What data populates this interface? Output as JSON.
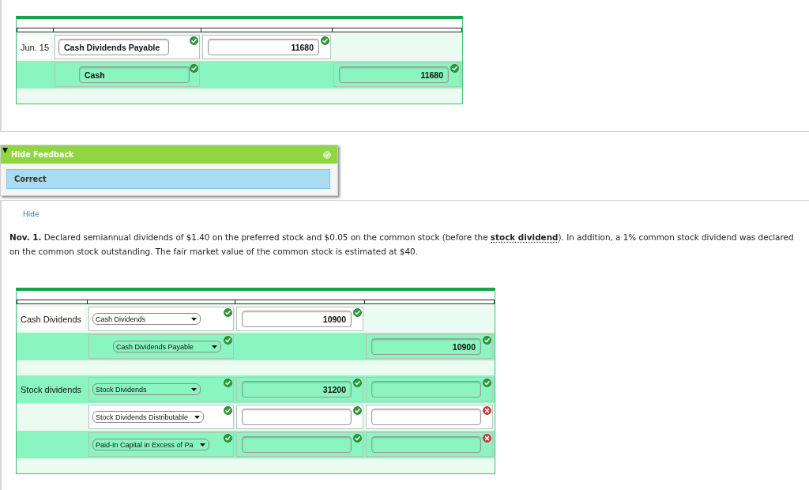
{
  "journal_1": {
    "rows": [
      {
        "kind": "entry",
        "column_1": "Jun. 15",
        "column_2": {
          "kind": "text",
          "value": "Cash Dividends Payable",
          "indented": false,
          "correct": true
        },
        "column_3": {
          "value": "11680",
          "correct": true
        }
      },
      {
        "kind": "entry",
        "column_2": {
          "kind": "text",
          "value": "Cash",
          "indented": true,
          "correct": true
        },
        "column_4": {
          "value": "11680",
          "correct": true
        }
      },
      {
        "kind": "spacer"
      }
    ]
  },
  "feedback": {
    "title": "Hide Feedback",
    "expanded": true,
    "correct": true,
    "message": "Correct"
  },
  "hide_link": "Hide",
  "question": {
    "before": "**Nov. 1.** Declared semiannual dividends of $1.40 on the preferred stock and $0.05 on the common stock (before the ",
    "term": "stock dividend",
    "after": "). In addition, a 1% common stock dividend was declared on the common stock outstanding. The fair market value of the common stock is estimated at $40."
  },
  "journal_2": {
    "rows": [
      {
        "kind": "entry",
        "column_1": "Cash Dividends",
        "column_2": {
          "kind": "select",
          "value": "Cash Dividends",
          "indented": false,
          "correct": true
        },
        "column_3": {
          "value": "10900",
          "correct": true
        }
      },
      {
        "kind": "entry",
        "column_2": {
          "kind": "select",
          "value": "Cash Dividends Payable",
          "indented": true,
          "correct": true
        },
        "column_4": {
          "value": "10900",
          "correct": true
        }
      },
      {
        "kind": "spacer"
      },
      {
        "kind": "entry",
        "column_1": "Stock dividends",
        "column_2": {
          "kind": "select",
          "value": "Stock Dividends",
          "indented": false,
          "correct": true
        },
        "column_3": {
          "value": "31200",
          "correct": true
        },
        "column_4": {
          "correct": true
        }
      },
      {
        "kind": "entry",
        "column_2": {
          "kind": "select",
          "value": "Stock Dividends Distributable",
          "indented": false,
          "correct": true
        },
        "column_3": {
          "correct": true
        },
        "column_4": {
          "correct": false
        }
      },
      {
        "kind": "entry",
        "column_2": {
          "kind": "select",
          "value": "Paid-In Capital in Excess of Pa",
          "indented": false,
          "correct": true
        },
        "column_3": {
          "correct": true
        },
        "column_4": {
          "correct": false
        }
      },
      {
        "kind": "spacer"
      }
    ]
  }
}
